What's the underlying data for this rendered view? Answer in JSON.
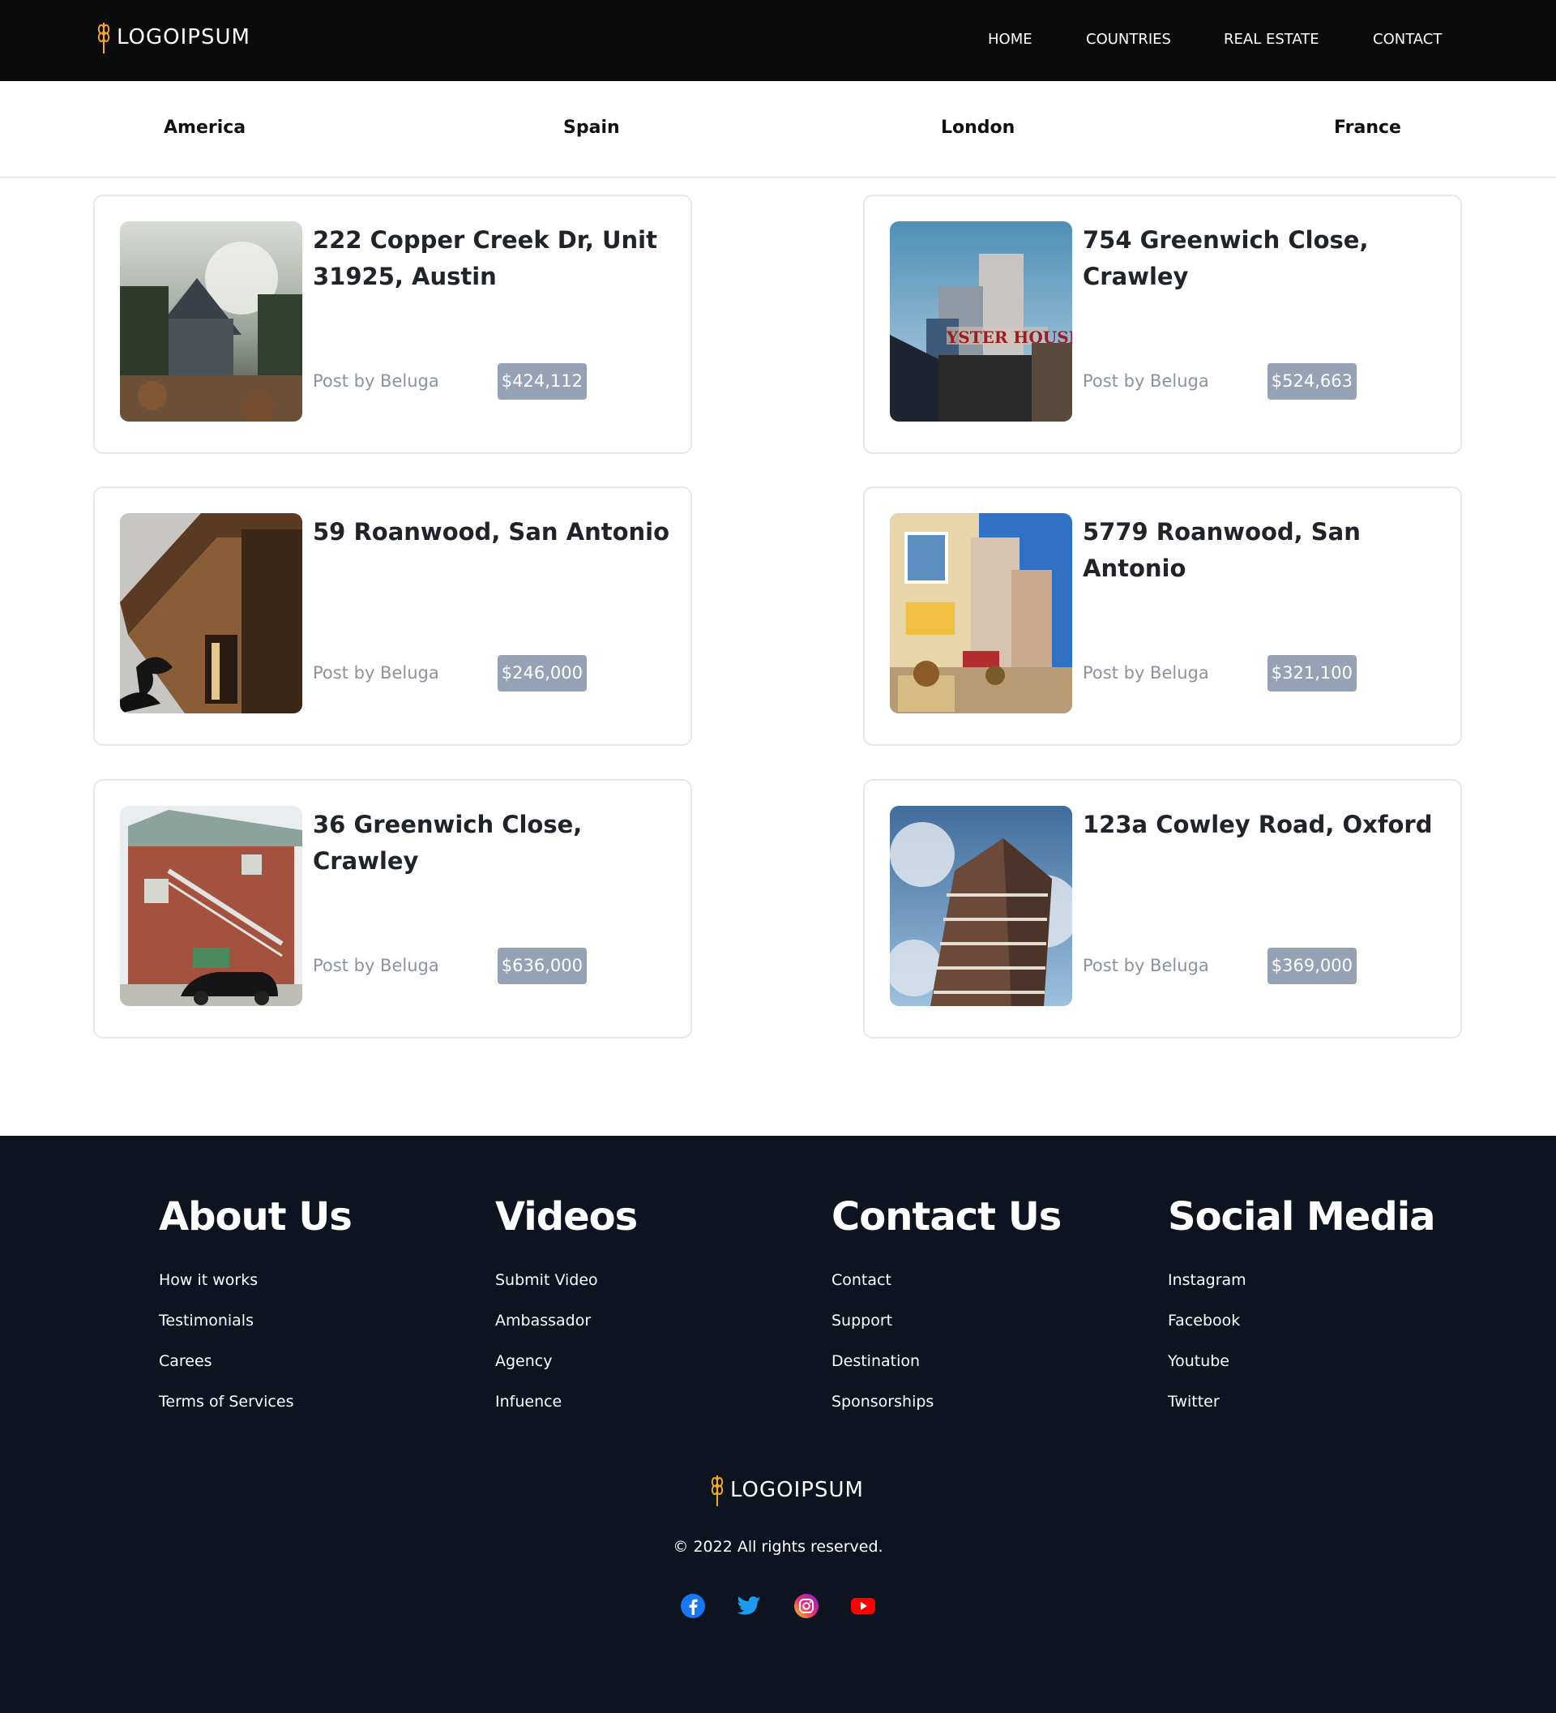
{
  "brand": {
    "name": "LOGOIPSUM",
    "accent": "#f5a623"
  },
  "nav": {
    "items": [
      "HOME",
      "COUNTRIES",
      "REAL ESTATE",
      "CONTACT"
    ]
  },
  "tabs": [
    "America",
    "Spain",
    "London",
    "France"
  ],
  "listings": [
    {
      "title": "222 Copper Creek Dr, Unit 31925, Austin",
      "author": "Post by Beluga",
      "price": "$424,112",
      "image": "house-in-forest-photo"
    },
    {
      "title": "754 Greenwich Close, Crawley",
      "author": "Post by Beluga",
      "price": "$524,663",
      "image": "city-tower-photo"
    },
    {
      "title": "59 Roanwood, San Antonio",
      "author": "Post by Beluga",
      "price": "$246,000",
      "image": "wooden-house-photo"
    },
    {
      "title": "5779 Roanwood, San Antonio",
      "author": "Post by Beluga",
      "price": "$321,100",
      "image": "row-houses-photo"
    },
    {
      "title": "36 Greenwich Close, Crawley",
      "author": "Post by Beluga",
      "price": "$636,000",
      "image": "brick-house-photo"
    },
    {
      "title": "123a Cowley Road, Oxford",
      "author": "Post by Beluga",
      "price": "$369,000",
      "image": "apartment-tower-photo"
    }
  ],
  "footer": {
    "columns": [
      {
        "title": "About Us",
        "links": [
          "How it works",
          "Testimonials",
          "Carees",
          "Terms of Services"
        ]
      },
      {
        "title": "Videos",
        "links": [
          "Submit Video",
          "Ambassador",
          "Agency",
          "Infuence"
        ]
      },
      {
        "title": "Contact Us",
        "links": [
          "Contact",
          "Support",
          "Destination",
          "Sponsorships"
        ]
      },
      {
        "title": "Social Media",
        "links": [
          "Instagram",
          "Facebook",
          "Youtube",
          "Twitter"
        ]
      }
    ],
    "copyright": "© 2022 All rights reserved.",
    "socials": [
      {
        "icon": "facebook-icon",
        "color": "#1877f2"
      },
      {
        "icon": "twitter-icon",
        "color": "#1d9bf0"
      },
      {
        "icon": "instagram-icon",
        "color": "#d6249f"
      },
      {
        "icon": "youtube-icon",
        "color": "#ff0000"
      }
    ]
  }
}
